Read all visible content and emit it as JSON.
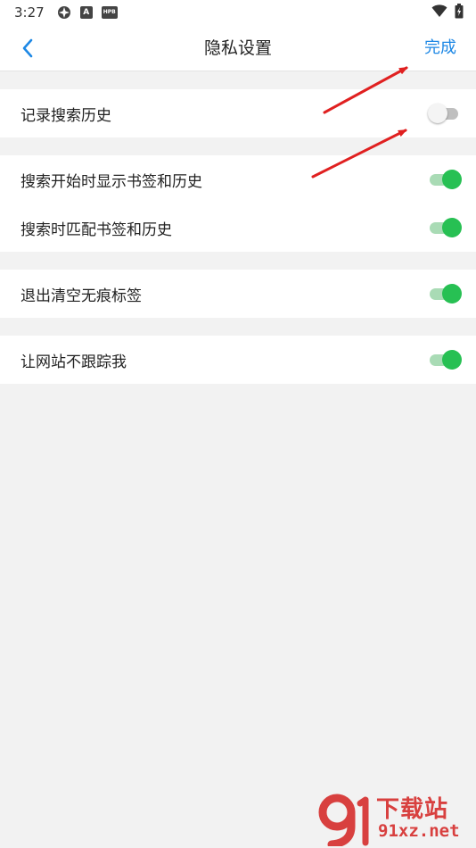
{
  "status_bar": {
    "time": "3:27",
    "icons": [
      "flower-app-icon",
      "a-app-icon",
      "hpb-app-icon"
    ],
    "hpb_label": "HPB",
    "a_label": "A",
    "right_icons": [
      "wifi-icon",
      "battery-charging-icon"
    ]
  },
  "header": {
    "title": "隐私设置",
    "done_label": "完成",
    "back_icon": "chevron-left-icon",
    "accent_color": "#1e88e5"
  },
  "groups": [
    {
      "rows": [
        {
          "label": "记录搜索历史",
          "enabled": false
        }
      ]
    },
    {
      "rows": [
        {
          "label": "搜索开始时显示书签和历史",
          "enabled": true
        },
        {
          "label": "搜索时匹配书签和历史",
          "enabled": true
        }
      ]
    },
    {
      "rows": [
        {
          "label": "退出清空无痕标签",
          "enabled": true
        }
      ]
    },
    {
      "rows": [
        {
          "label": "让网站不跟踪我",
          "enabled": true
        }
      ]
    }
  ],
  "colors": {
    "toggle_on": "#27c053",
    "toggle_off": "#bfbfbf",
    "annotation_arrow": "#e02020"
  },
  "watermark": {
    "top_text": "下载站",
    "bottom_text": "91xz.net",
    "logo_glyph": "9"
  }
}
